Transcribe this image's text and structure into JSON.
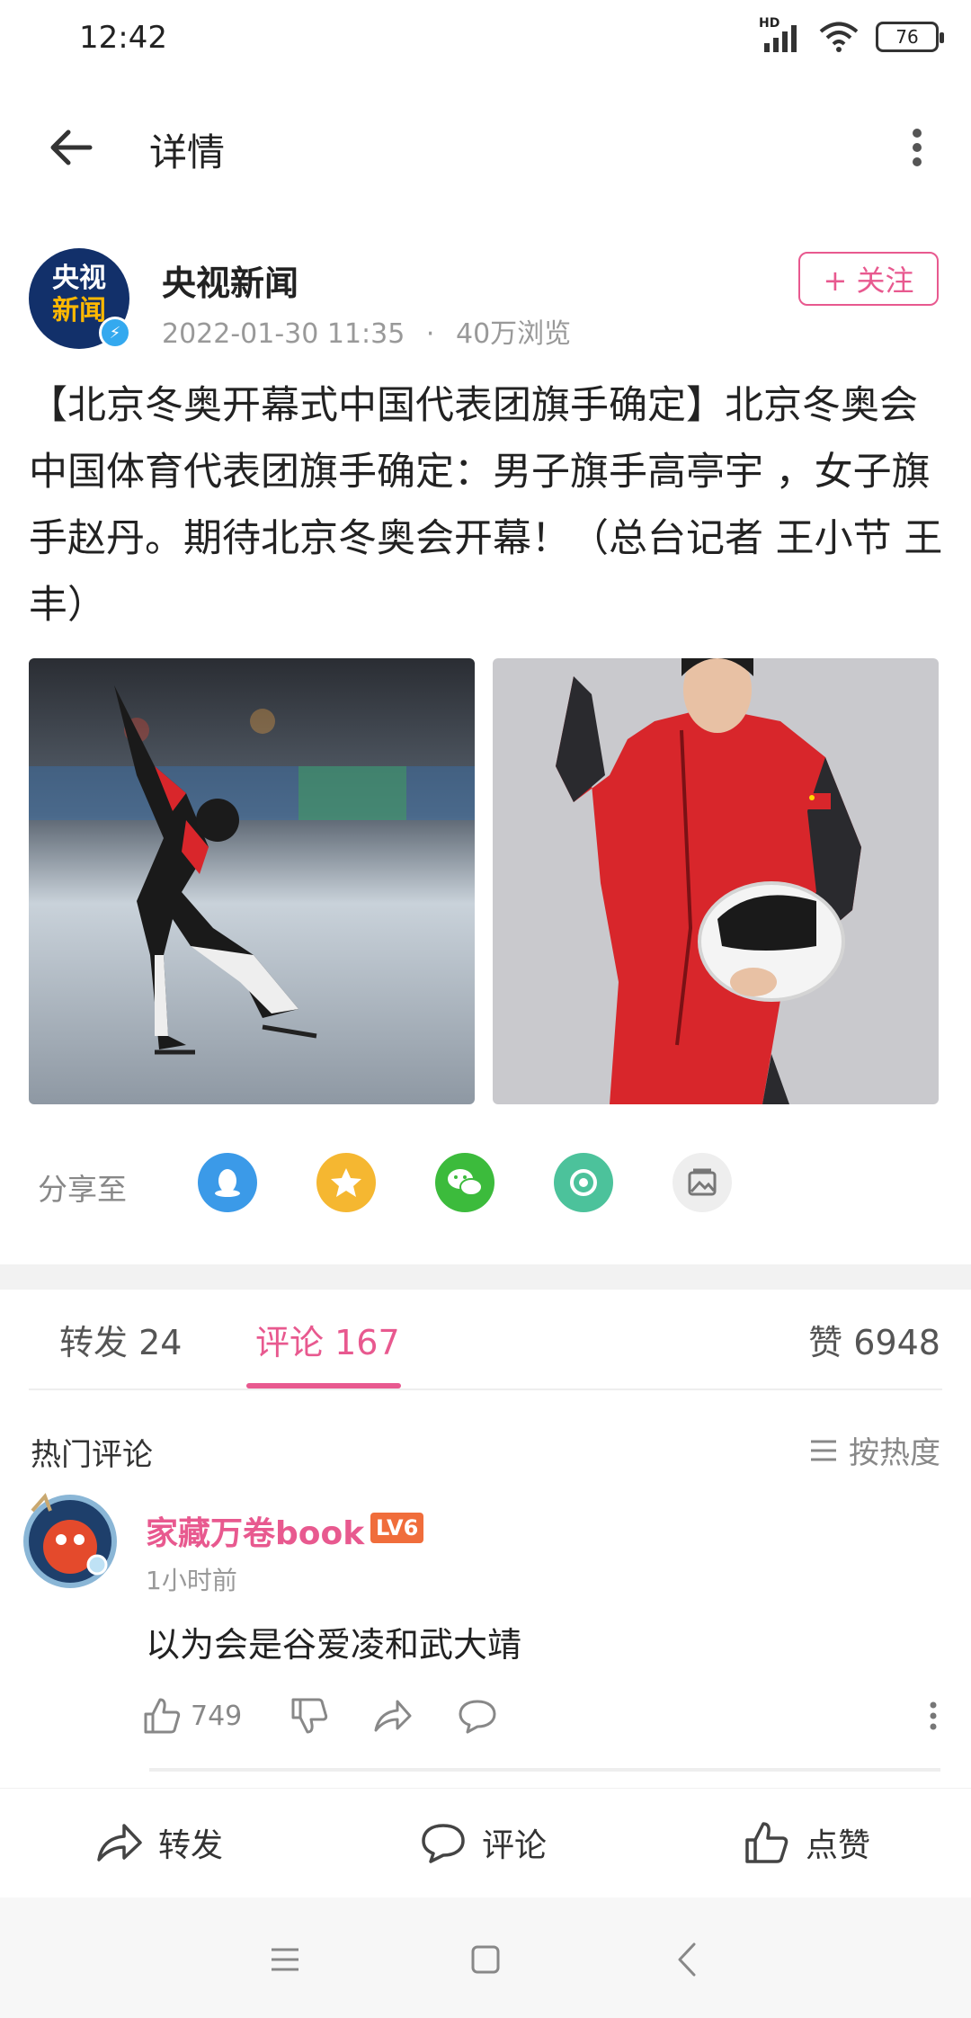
{
  "status_bar": {
    "time": "12:42",
    "network_label": "HD",
    "battery": "76"
  },
  "nav": {
    "title": "详情"
  },
  "author": {
    "avatar_line1": "央视",
    "avatar_line2": "新闻",
    "name": "央视新闻",
    "date": "2022-01-30 11:35",
    "dot": "·",
    "views": "40万浏览",
    "follow_label": "+ 关注"
  },
  "post": {
    "text": "【北京冬奥开幕式中国代表团旗手确定】北京冬奥会中国体育代表团旗手确定：男子旗手高亭宇 ，女子旗手赵丹。期待北京冬奥会开幕！（总台记者 王小节 王丰）"
  },
  "share": {
    "label": "分享至",
    "targets": [
      "qq-icon",
      "qzone-icon",
      "wechat-icon",
      "moments-icon",
      "save-image-icon"
    ]
  },
  "tabs": {
    "repost_label": "转发",
    "repost_count": "24",
    "comment_label": "评论",
    "comment_count": "167",
    "like_label": "赞",
    "like_count": "6948"
  },
  "comments": {
    "section_title": "热门评论",
    "sort_label": "按热度",
    "items": [
      {
        "user": "家藏万卷book",
        "level": "LV6",
        "time": "1小时前",
        "text": "以为会是谷爱凌和武大靖",
        "likes": "749"
      }
    ]
  },
  "bottom_bar": {
    "repost": "转发",
    "comment": "评论",
    "like": "点赞"
  },
  "colors": {
    "accent": "#e8598f",
    "qq": "#3b9ae8",
    "qzone": "#f5b731",
    "wechat": "#3cbb3c",
    "moments": "#4cc29b"
  }
}
